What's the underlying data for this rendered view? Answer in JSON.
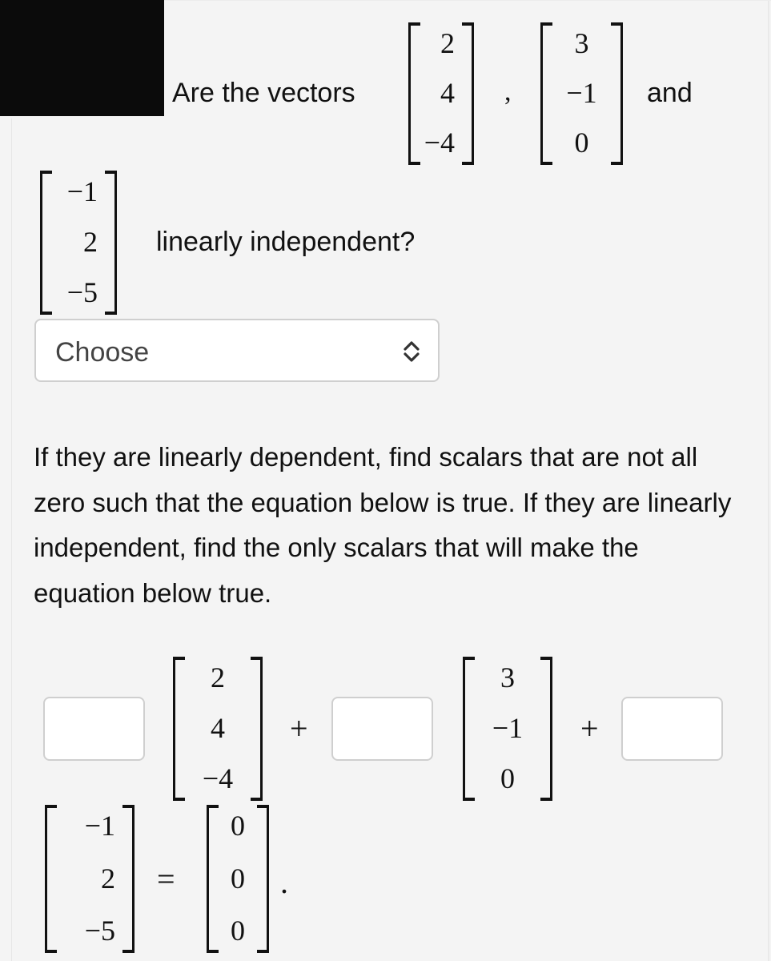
{
  "question": {
    "prefix": "Are the vectors",
    "vectors": [
      [
        "2",
        "4",
        "−4"
      ],
      [
        "3",
        "−1",
        "0"
      ],
      [
        "−1",
        "2",
        "−5"
      ]
    ],
    "separator": ",",
    "conjunction": "and",
    "suffix": "linearly independent?"
  },
  "answer_select": {
    "value": "Choose",
    "icon": "chevron-up-down-icon"
  },
  "instructions": "If they are linearly dependent, find scalars that are not all zero such that the equation below is true. If they are linearly independent, find the only scalars that will make the equation below true.",
  "equation": {
    "plus": "+",
    "equals": "=",
    "period": ".",
    "scalar_inputs": [
      {
        "value": ""
      },
      {
        "value": ""
      },
      {
        "value": ""
      }
    ],
    "zero_vector": [
      "0",
      "0",
      "0"
    ]
  }
}
